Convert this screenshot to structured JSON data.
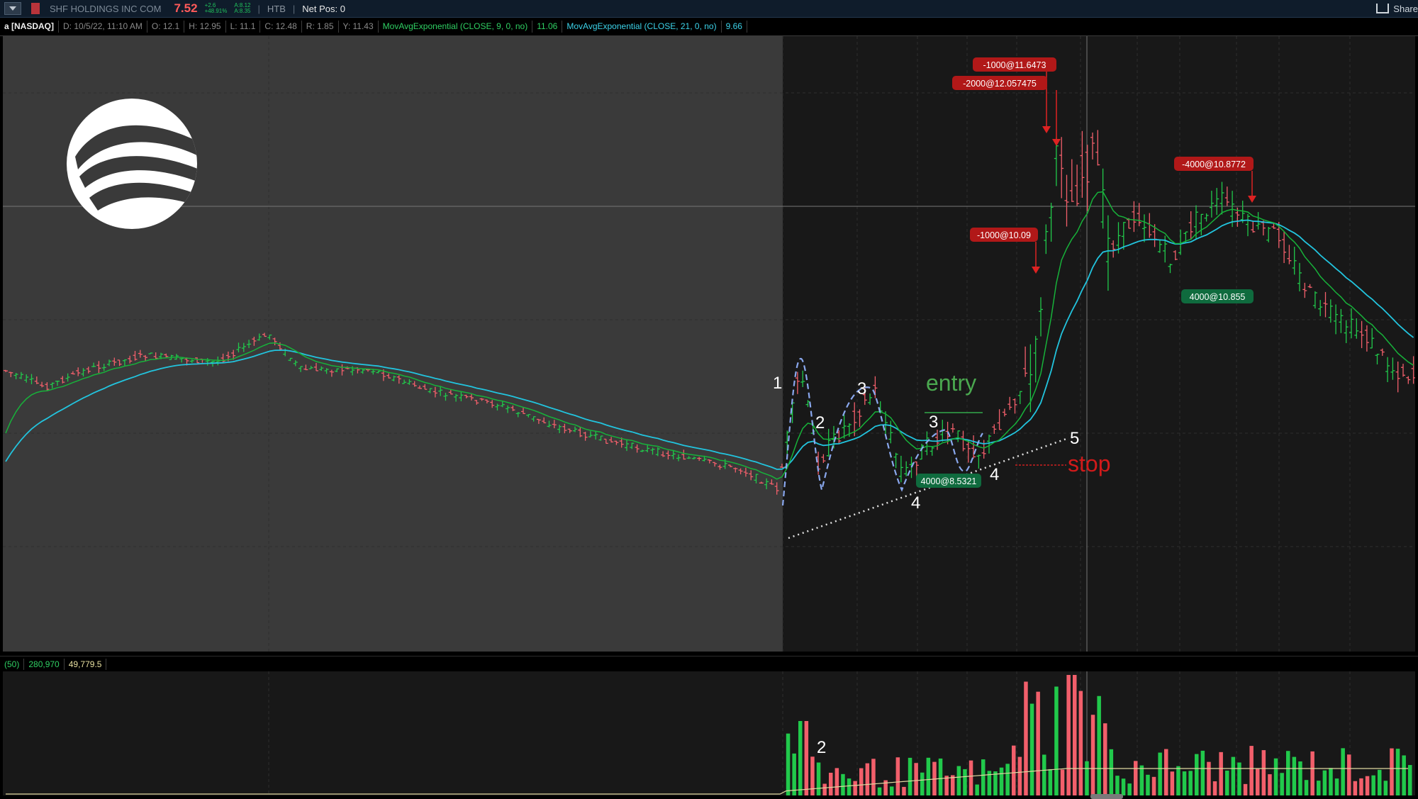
{
  "toolbar": {
    "symbol_name": "SHF HOLDINGS INC COM",
    "price": "7.52",
    "change_top": "+2.6",
    "change_bottom": "+48.91%",
    "bid_top": "A:8.12",
    "bid_bottom": "A:8.35",
    "htb": "HTB",
    "net_pos": "Net Pos: 0",
    "share": "Share"
  },
  "infobar": {
    "exchange": "a [NASDAQ]",
    "date": "D: 10/5/22, 11:10 AM",
    "open": "O: 12.1",
    "high": "H: 12.95",
    "low": "L: 11.1",
    "close": "C: 12.48",
    "range": "R: 1.85",
    "y": "Y: 11.43",
    "ema9_label": "MovAvgExponential (CLOSE, 9, 0, no)",
    "ema9_value": "11.06",
    "ema21_label": "MovAvgExponential (CLOSE, 21, 0, no)",
    "ema21_value": "9.66"
  },
  "volume_header": {
    "period": "(50)",
    "volume": "280,970",
    "avg": "49,779.5"
  },
  "colors": {
    "up": "#21c94b",
    "down": "#f25f6b",
    "ema9": "#17b23a",
    "ema21": "#22c4de",
    "premarket_bg": "#3a3a3a",
    "panel_bg": "#181818",
    "order_sell": "#b11818",
    "order_buy": "#0f6b3e"
  },
  "annotations": {
    "wave_1": "1",
    "wave_2": "2",
    "wave_3a": "3",
    "wave_3b": "3",
    "wave_4a": "4",
    "wave_4b": "4",
    "wave_5": "5",
    "entry": "entry",
    "stop": "stop",
    "vol_2": "2"
  },
  "orders": {
    "sell1": "-1000@11.6473",
    "sell2": "-2000@12.057475",
    "sell3": "-1000@10.09",
    "sell4": "-4000@10.8772",
    "buy1": "4000@10.855",
    "buy2": "4000@8.5321"
  },
  "icons": {
    "logo": "shf-wave-logo",
    "menu": "chevron-down-icon",
    "share": "share-icon"
  }
}
